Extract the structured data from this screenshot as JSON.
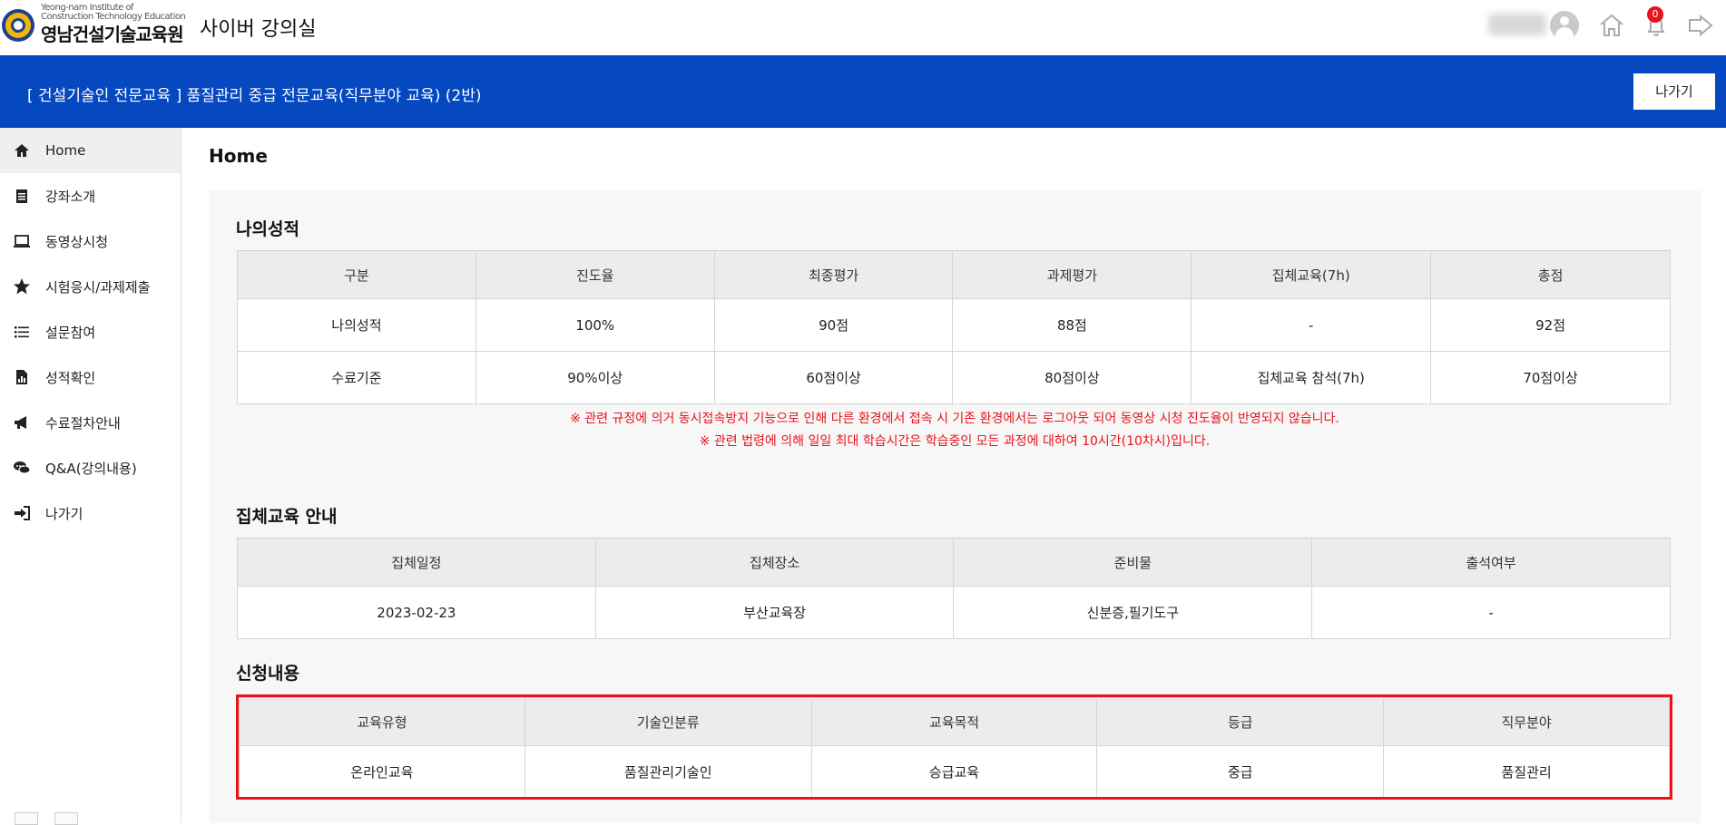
{
  "header": {
    "logo_en": "Yeong-nam Institute of\nConstruction Technology Education",
    "logo_ko": "영남건설기술교육원",
    "site_title": "사이버 강의실",
    "notification_count": "0"
  },
  "banner": {
    "course_title": "[ 건설기술인 전문교육 ] 품질관리 중급 전문교육(직무분야 교육) (2반)",
    "exit_label": "나가기"
  },
  "sidebar": {
    "items": [
      {
        "label": "Home",
        "icon": "home-icon"
      },
      {
        "label": "강좌소개",
        "icon": "notepad-icon"
      },
      {
        "label": "동영상시청",
        "icon": "laptop-icon"
      },
      {
        "label": "시험응시/과제제출",
        "icon": "star-icon"
      },
      {
        "label": "설문참여",
        "icon": "list-icon"
      },
      {
        "label": "성적확인",
        "icon": "report-icon"
      },
      {
        "label": "수료절차안내",
        "icon": "megaphone-icon"
      },
      {
        "label": "Q&A(강의내용)",
        "icon": "chat-icon"
      },
      {
        "label": "나가기",
        "icon": "sign-out-icon"
      }
    ]
  },
  "main": {
    "page_title": "Home",
    "grades": {
      "title": "나의성적",
      "headers": [
        "구분",
        "진도율",
        "최종평가",
        "과제평가",
        "집체교육(7h)",
        "총점"
      ],
      "rows": [
        [
          "나의성적",
          "100%",
          "90점",
          "88점",
          "-",
          "92점"
        ],
        [
          "수료기준",
          "90%이상",
          "60점이상",
          "80점이상",
          "집체교육 참석(7h)",
          "70점이상"
        ]
      ],
      "notices": [
        "※ 관련 규정에 의거 동시접속방지 기능으로 인해 다른 환경에서 접속 시 기존 환경에서는 로그아웃 되어 동영상 시청 진도율이 반영되지 않습니다.",
        "※ 관련 법령에 의해 일일 최대 학습시간은 학습중인 모든 과정에 대하여 10시간(10차시)입니다."
      ]
    },
    "group_training": {
      "title": "집체교육 안내",
      "headers": [
        "집체일정",
        "집체장소",
        "준비물",
        "출석여부"
      ],
      "row": [
        "2023-02-23",
        "부산교육장",
        "신분증,필기도구",
        "-"
      ]
    },
    "application": {
      "title": "신청내용",
      "headers": [
        "교육유형",
        "기술인분류",
        "교육목적",
        "등급",
        "직무분야"
      ],
      "row": [
        "온라인교육",
        "품질관리기술인",
        "승급교육",
        "중급",
        "품질관리"
      ]
    }
  },
  "colors": {
    "banner": "#0548c0",
    "accent_red": "#e8141c"
  }
}
